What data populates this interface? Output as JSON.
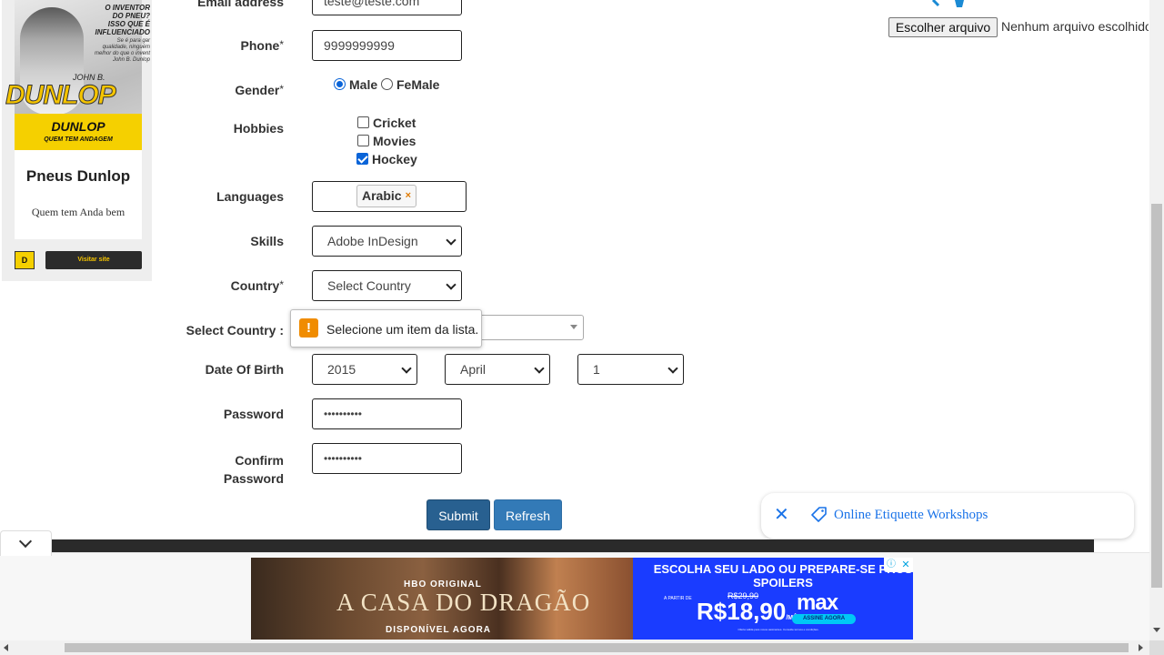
{
  "left_ad": {
    "headline": "O INVENTOR DO PNEU? ISSO QUE É INFLUENCIADO",
    "body_small": "Se é para gar qualidade, ninguém melhor do que o invent John B. Dunlop",
    "signature": "JOHN B.",
    "brand_big": "DUNLOP",
    "logo": "DUNLOP",
    "slogan_small": "QUEM TEM ANDAGEM",
    "card_title": "Pneus Dunlop",
    "card_subtitle": "Quem tem Anda bem",
    "logo_mark": "D",
    "visit_label": "Visitar site"
  },
  "form": {
    "email": {
      "label": "Email address",
      "value": "teste@teste.com"
    },
    "phone": {
      "label": "Phone",
      "required_mark": "*",
      "value": "9999999999"
    },
    "gender": {
      "label": "Gender",
      "required_mark": "*",
      "options": [
        {
          "label": "Male",
          "checked": true
        },
        {
          "label": "FeMale",
          "checked": false
        }
      ]
    },
    "hobbies": {
      "label": "Hobbies",
      "options": [
        {
          "label": "Cricket",
          "checked": false
        },
        {
          "label": "Movies",
          "checked": false
        },
        {
          "label": "Hockey",
          "checked": true
        }
      ]
    },
    "languages": {
      "label": "Languages",
      "selected_tag": "Arabic",
      "remove_glyph": "×"
    },
    "skills": {
      "label": "Skills",
      "value": "Adobe InDesign"
    },
    "country": {
      "label": "Country",
      "required_mark": "*",
      "value": "Select Country"
    },
    "select_country": {
      "label": "Select Country :"
    },
    "validation_tooltip": {
      "icon": "!",
      "message": "Selecione um item da lista."
    },
    "dob": {
      "label": "Date Of Birth",
      "year": "2015",
      "month": "April",
      "day": "1"
    },
    "password": {
      "label": "Password",
      "value": "••••••••••"
    },
    "confirm_password": {
      "label_line1": "Confirm",
      "label_line2": "Password",
      "value": "••••••••••"
    },
    "submit_label": "Submit",
    "refresh_label": "Refresh"
  },
  "upload": {
    "button_label": "Escolher arquivo",
    "status": "Nenhum arquivo escolhido"
  },
  "toast": {
    "close_glyph": "✕",
    "text": "Online Etiquette Workshops"
  },
  "bottom_ad": {
    "hbo_label": "HBO ORIGINAL",
    "title": "A CASA DO DRAGÃO",
    "available": "DISPONÍVEL AGORA",
    "headline": "ESCOLHA SEU LADO OU PREPARE-SE PROS SPOILERS",
    "from_label": "A PARTIR DE",
    "old_price": "R$29,90",
    "price": "R$18,90",
    "per_month": "/MÊS",
    "brand": "max",
    "cta": "ASSINE AGORA",
    "fine_print": "Oferta válida para novos assinantes. Consulte termos e condições.",
    "adchoices_glyph": "ⓘ",
    "close_glyph": "✕"
  },
  "colors": {
    "primary_button": "#286090",
    "secondary_button": "#337ab7",
    "checkbox_blue": "#0a64d8",
    "warning_orange": "#f08c00",
    "toast_link": "#1a73e8",
    "ad_blue": "#1a3cff"
  }
}
